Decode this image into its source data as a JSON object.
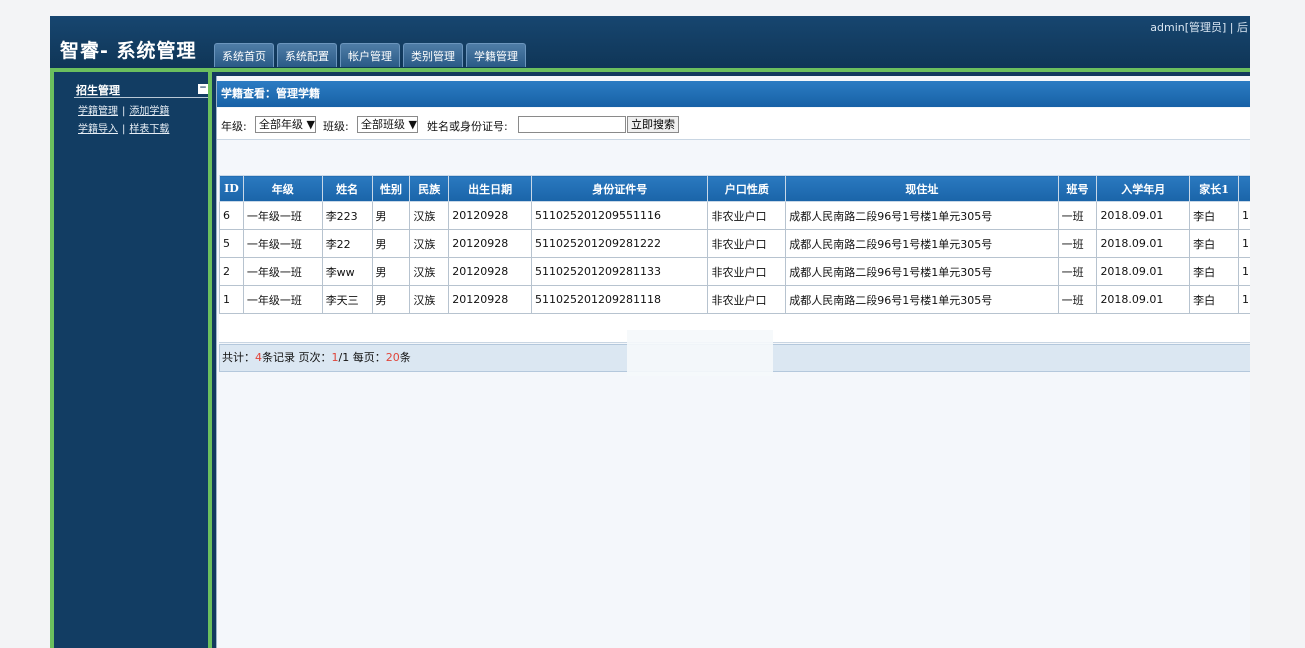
{
  "app": {
    "title": "智睿- 系统管理",
    "user_bar": "admin[管理员] | 后"
  },
  "tabs": [
    "系统首页",
    "系统配置",
    "帐户管理",
    "类别管理",
    "学籍管理"
  ],
  "sidebar": {
    "title": "招生管理",
    "collapse_icon": "minus-box-icon",
    "links_row1": [
      "学籍管理",
      "添加学籍"
    ],
    "links_row2": [
      "学籍导入",
      "样表下载"
    ],
    "separator": "|"
  },
  "panel": {
    "title": "学籍查看：管理学籍"
  },
  "search": {
    "grade_label": "年级:",
    "grade_value": "全部年级 ▼",
    "class_label": "班级:",
    "class_value": "全部班级 ▼",
    "keyword_label": "姓名或身份证号:",
    "keyword_value": "",
    "button_label": "立即搜索"
  },
  "table": {
    "headers": [
      "ID",
      "年级",
      "姓名",
      "性别",
      "民族",
      "出生日期",
      "身份证件号",
      "户口性质",
      "现住址",
      "班号",
      "入学年月",
      "家长1",
      ""
    ],
    "rows": [
      [
        "6",
        "一年级一班",
        "李223",
        "男",
        "汉族",
        "20120928",
        "511025201209551116",
        "非农业户口",
        "成都人民南路二段96号1号楼1单元305号",
        "一班",
        "2018.09.01",
        "李白",
        "1"
      ],
      [
        "5",
        "一年级一班",
        "李22",
        "男",
        "汉族",
        "20120928",
        "511025201209281222",
        "非农业户口",
        "成都人民南路二段96号1号楼1单元305号",
        "一班",
        "2018.09.01",
        "李白",
        "1"
      ],
      [
        "2",
        "一年级一班",
        "李ww",
        "男",
        "汉族",
        "20120928",
        "511025201209281133",
        "非农业户口",
        "成都人民南路二段96号1号楼1单元305号",
        "一班",
        "2018.09.01",
        "李白",
        "1"
      ],
      [
        "1",
        "一年级一班",
        "李天三",
        "男",
        "汉族",
        "20120928",
        "511025201209281118",
        "非农业户口",
        "成都人民南路二段96号1号楼1单元305号",
        "一班",
        "2018.09.01",
        "李白",
        "1"
      ]
    ]
  },
  "footer": {
    "total_prefix": "共计：",
    "total_count": "4",
    "total_suffix": "条记录 页次：",
    "page_current": "1",
    "page_total": "/1 每页：",
    "per_page": "20",
    "per_page_suffix": "条"
  }
}
